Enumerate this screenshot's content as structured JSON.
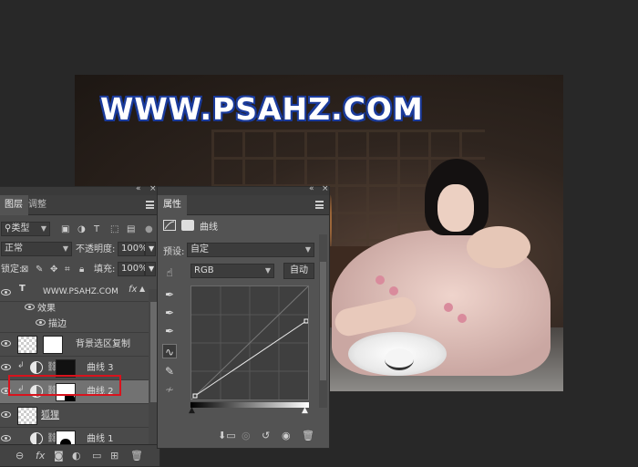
{
  "watermark": "WWW.PSAHZ.COM",
  "layers_panel": {
    "tabs": [
      "图层",
      "调整"
    ],
    "filter_kind": "类型",
    "blend_mode": "正常",
    "opacity_label": "不透明度:",
    "opacity_value": "100%",
    "lock_label": "锁定:",
    "fill_label": "填充:",
    "fill_value": "100%",
    "layers": [
      {
        "type": "text",
        "name": "WWW.PSAHZ.COM",
        "fx": "fx"
      },
      {
        "type": "effects",
        "name": "效果"
      },
      {
        "type": "effect",
        "name": "描边"
      },
      {
        "type": "pixel",
        "name": "背景选区复制"
      },
      {
        "type": "curves",
        "name": "曲线 3",
        "clipped": true
      },
      {
        "type": "curves",
        "name": "曲线 2",
        "clipped": true,
        "selected": true
      },
      {
        "type": "pixel",
        "name": "狐狸"
      },
      {
        "type": "curves",
        "name": "曲线 1"
      }
    ],
    "footer_icons": [
      "link-icon",
      "fx-icon",
      "mask-icon",
      "adjustment-icon",
      "folder-icon",
      "new-layer-icon",
      "trash-icon"
    ],
    "fx_label": "fx"
  },
  "properties_panel": {
    "tab": "属性",
    "adjustment_title": "曲线",
    "preset_label": "预设:",
    "preset_value": "自定",
    "channel_value": "RGB",
    "auto_button": "自动",
    "tool_icons": [
      "on-image-adjust-icon",
      "eyedropper-black-icon",
      "eyedropper-gray-icon",
      "eyedropper-white-icon",
      "curve-point-icon",
      "pencil-icon",
      "smooth-icon"
    ],
    "footer_icons": [
      "clip-to-layer-icon",
      "view-previous-icon",
      "reset-icon",
      "visibility-icon",
      "trash-icon"
    ]
  }
}
